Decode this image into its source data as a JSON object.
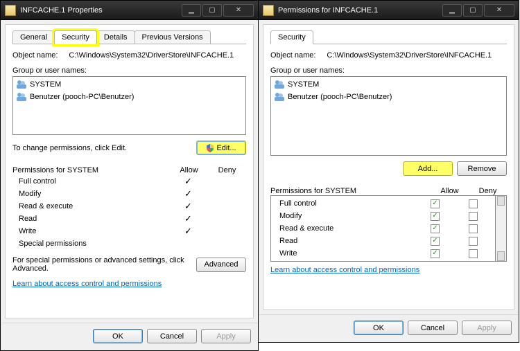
{
  "left": {
    "title": "INFCACHE.1 Properties",
    "tabs": [
      "General",
      "Security",
      "Details",
      "Previous Versions"
    ],
    "active_tab": 1,
    "object_name_label": "Object name:",
    "object_path": "C:\\Windows\\System32\\DriverStore\\INFCACHE.1",
    "group_label": "Group or user names:",
    "users": [
      "SYSTEM",
      "Benutzer (pooch-PC\\Benutzer)"
    ],
    "change_text": "To change permissions, click Edit.",
    "edit_btn": "Edit...",
    "perm_label": "Permissions for SYSTEM",
    "col_allow": "Allow",
    "col_deny": "Deny",
    "perms": [
      {
        "name": "Full control",
        "allow": true,
        "deny": false
      },
      {
        "name": "Modify",
        "allow": true,
        "deny": false
      },
      {
        "name": "Read & execute",
        "allow": true,
        "deny": false
      },
      {
        "name": "Read",
        "allow": true,
        "deny": false
      },
      {
        "name": "Write",
        "allow": true,
        "deny": false
      },
      {
        "name": "Special permissions",
        "allow": false,
        "deny": false
      }
    ],
    "adv_text": "For special permissions or advanced settings, click Advanced.",
    "adv_btn": "Advanced",
    "link": "Learn about access control and permissions",
    "ok": "OK",
    "cancel": "Cancel",
    "apply": "Apply"
  },
  "right": {
    "title": "Permissions for INFCACHE.1",
    "tab": "Security",
    "object_name_label": "Object name:",
    "object_path": "C:\\Windows\\System32\\DriverStore\\INFCACHE.1",
    "group_label": "Group or user names:",
    "users": [
      "SYSTEM",
      "Benutzer (pooch-PC\\Benutzer)"
    ],
    "add_btn": "Add...",
    "remove_btn": "Remove",
    "perm_label": "Permissions for SYSTEM",
    "col_allow": "Allow",
    "col_deny": "Deny",
    "perms": [
      {
        "name": "Full control",
        "allow": true,
        "deny": false
      },
      {
        "name": "Modify",
        "allow": true,
        "deny": false
      },
      {
        "name": "Read & execute",
        "allow": true,
        "deny": false
      },
      {
        "name": "Read",
        "allow": true,
        "deny": false
      },
      {
        "name": "Write",
        "allow": true,
        "deny": false
      }
    ],
    "link": "Learn about access control and permissions",
    "ok": "OK",
    "cancel": "Cancel",
    "apply": "Apply"
  }
}
